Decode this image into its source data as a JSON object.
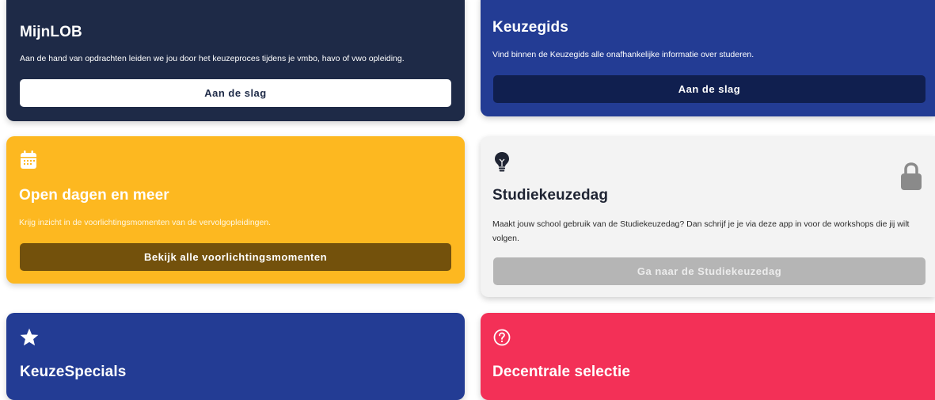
{
  "cards": [
    {
      "title": "MijnLOB",
      "description": "Aan de hand van opdrachten leiden we jou door het keuzeproces tijdens je vmbo, havo of vwo opleiding.",
      "button": "Aan de slag",
      "color": "#1e2a47"
    },
    {
      "title": "Keuzegids",
      "description": "Vind binnen de Keuzegids alle onafhankelijke informatie over studeren.",
      "button": "Aan de slag",
      "color": "#233c94"
    },
    {
      "title": "Open dagen en meer",
      "description": "Krijg inzicht in de voorlichtingsmomenten van de vervolgopleidingen.",
      "button": "Bekijk alle voorlichtingsmomenten",
      "icon": "calendar-icon",
      "color": "#fdb820"
    },
    {
      "title": "Studiekeuzedag",
      "description": "Maakt jouw school gebruik van de Studiekeuzedag? Dan schrijf je je via deze app in voor de workshops die jij wilt volgen.",
      "button": "Ga naar de Studiekeuzedag",
      "icon": "lightbulb-icon",
      "locked": true,
      "color": "#f3f3f3"
    },
    {
      "title": "KeuzeSpecials",
      "icon": "star-icon",
      "color": "#233c94"
    },
    {
      "title": "Decentrale selectie",
      "icon": "question-circle-icon",
      "color": "#f33057"
    }
  ]
}
